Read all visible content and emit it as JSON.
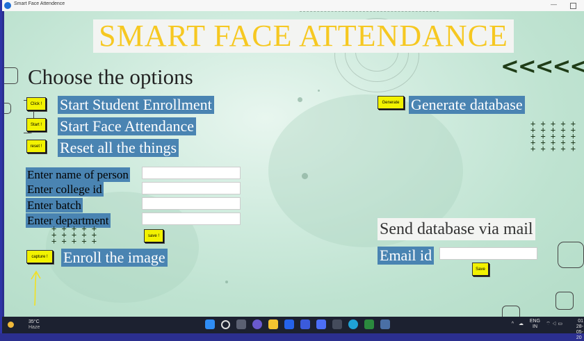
{
  "window": {
    "title": "Smart Face Attendence"
  },
  "header": {
    "title": "SMART FACE ATTENDANCE",
    "chevrons": "<<<<<"
  },
  "options": {
    "heading": "Choose the options",
    "enroll": {
      "button": "Click !",
      "label": "Start Student Enrollment"
    },
    "attendance": {
      "button": "Start !",
      "label": "Start Face Attendance"
    },
    "reset": {
      "button": "reset !",
      "label": "Reset all the things"
    },
    "generate": {
      "button": "Generate",
      "label": "Generate database"
    }
  },
  "form": {
    "name_label": "Enter name of person",
    "college_id_label": "Enter college id",
    "batch_label": "Enter batch",
    "department_label": "Enter department",
    "save_button": "save !",
    "name_value": "",
    "college_id_value": "",
    "batch_value": "",
    "department_value": ""
  },
  "capture": {
    "button": "capture !",
    "label": "Enroll the image"
  },
  "mail": {
    "heading": "Send database via mail",
    "email_label": "Email id",
    "email_value": "",
    "save_button": "Save"
  },
  "decor": {
    "plus_grid": "+ + + + +\n+ + + + +\n+ + + + +\n+ + + + +\n+ + + + +",
    "plus_small": "+ + + + +\n+ + + + +\n+ + + + +"
  },
  "taskbar": {
    "temperature": "35°C",
    "weather": "Haze",
    "lang_top": "ENG",
    "lang_bottom": "IN",
    "time": "01",
    "date": "28-05-20"
  },
  "colors": {
    "accent_yellow": "#f2f200",
    "label_blue": "#4a84b2",
    "title_gold": "#f6c821"
  }
}
